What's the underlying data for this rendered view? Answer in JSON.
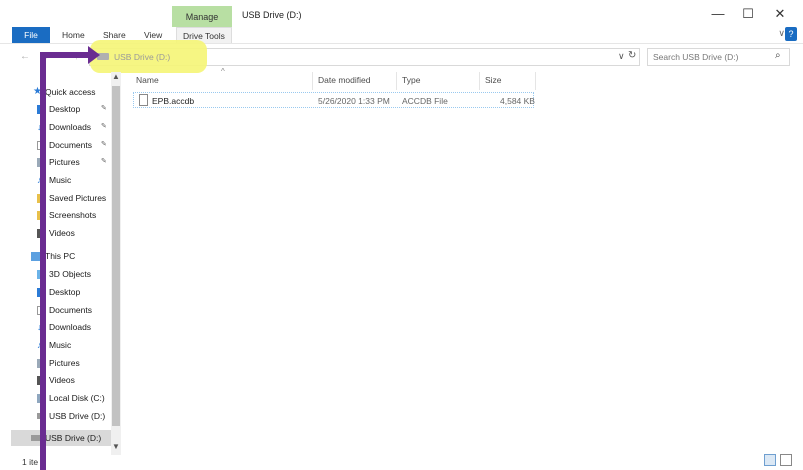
{
  "window": {
    "title": "USB Drive (D:)",
    "context_tab": "Manage",
    "minimize": "—",
    "maximize": "☐",
    "close": "✕"
  },
  "ribbon": {
    "tabs": [
      "File",
      "Home",
      "Share",
      "View",
      "Drive Tools"
    ],
    "collapse": "∨",
    "help": "?"
  },
  "address": {
    "back": "←",
    "forward": "→",
    "recent": "∨",
    "up": "↑",
    "path": "USB Drive (D:)",
    "dropdown": "∨",
    "refresh": "↻",
    "search_placeholder": "Search USB Drive (D:)",
    "search_icon": "⌕"
  },
  "nav": {
    "quick_access": "Quick access",
    "quick_items": [
      "Desktop",
      "Downloads",
      "Documents",
      "Pictures",
      "Music",
      "Saved Pictures",
      "Screenshots",
      "Videos"
    ],
    "this_pc": "This PC",
    "pc_items": [
      "3D Objects",
      "Desktop",
      "Documents",
      "Downloads",
      "Music",
      "Pictures",
      "Videos",
      "Local Disk (C:)",
      "USB Drive (D:)"
    ],
    "drive": "USB Drive (D:)",
    "pin_glyph": "📌"
  },
  "columns": [
    "Name",
    "Date modified",
    "Type",
    "Size"
  ],
  "files": [
    {
      "name": "EPB.accdb",
      "date": "5/26/2020 1:33 PM",
      "type": "ACCDB File",
      "size": "4,584 KB"
    }
  ],
  "status": {
    "text": "1 ite"
  },
  "colors": {
    "accent": "#1a6cc2",
    "manage_tab": "#b8dfa3",
    "highlight": "#f5f575",
    "arrow": "#6a2c91"
  }
}
